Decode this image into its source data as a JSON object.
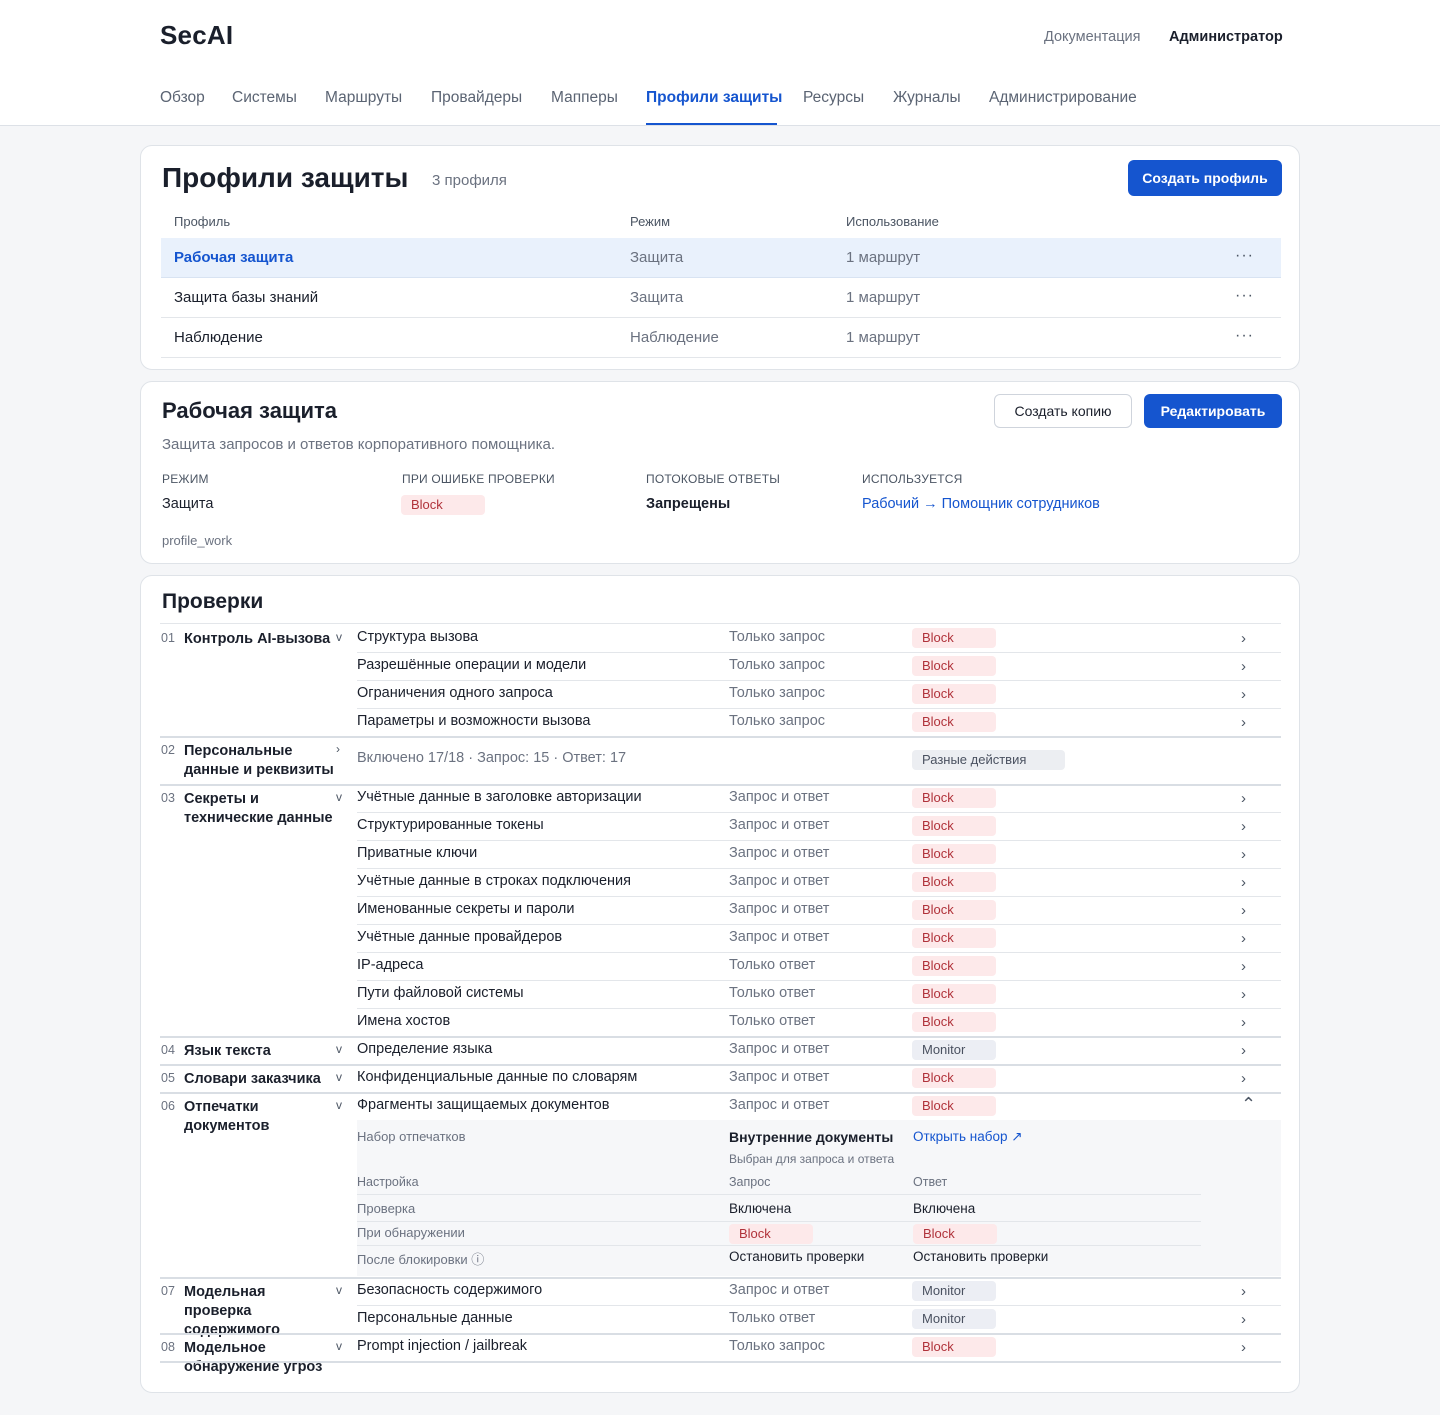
{
  "app": {
    "logo": "SecAI",
    "docs_link": "Документация",
    "user": "Администратор"
  },
  "nav": [
    "Обзор",
    "Системы",
    "Маршруты",
    "Провайдеры",
    "Мапперы",
    "Профили защиты",
    "Ресурсы",
    "Журналы",
    "Администрирование"
  ],
  "profiles": {
    "title": "Профили защиты",
    "count": "3 профиля",
    "create_button": "Создать профиль",
    "columns": [
      "Профиль",
      "Режим",
      "Использование"
    ],
    "rows": [
      {
        "name": "Рабочая защита",
        "mode": "Защита",
        "usage": "1 маршрут",
        "menu": "···"
      },
      {
        "name": "Защита базы знаний",
        "mode": "Защита",
        "usage": "1 маршрут",
        "menu": "···"
      },
      {
        "name": "Наблюдение",
        "mode": "Наблюдение",
        "usage": "1 маршрут",
        "menu": "···"
      }
    ]
  },
  "detail": {
    "title": "Рабочая защита",
    "description": "Защита запросов и ответов корпоративного помощника.",
    "copy_button": "Создать копию",
    "edit_button": "Редактировать",
    "fields": {
      "mode_label": "РЕЖИМ",
      "mode_value": "Защита",
      "on_error_label": "ПРИ ОШИБКЕ ПРОВЕРКИ",
      "on_error_value": "Block",
      "streaming_label": "ПОТОКОВЫЕ ОТВЕТЫ",
      "streaming_value": "Запрещены",
      "used_label": "ИСПОЛЬЗУЕТСЯ",
      "used_value": "Рабочий → Помощник сотрудников"
    },
    "id": "profile_work"
  },
  "checks": {
    "title": "Проверки",
    "groups": [
      {
        "num": "01",
        "name": "Контроль AI-вызова",
        "chev": "v",
        "items": [
          {
            "name": "Структура вызова",
            "dir": "Только запрос",
            "action": "Block"
          },
          {
            "name": "Разрешённые операции и модели",
            "dir": "Только запрос",
            "action": "Block"
          },
          {
            "name": "Ограничения одного запроса",
            "dir": "Только запрос",
            "action": "Block"
          },
          {
            "name": "Параметры и возможности вызова",
            "dir": "Только запрос",
            "action": "Block"
          }
        ]
      },
      {
        "num": "02",
        "name": "Персональные данные и реквизиты",
        "chev": "›",
        "summary": "Включено 17/18 · Запрос: 15 · Ответ: 17",
        "summary_action": "Разные действия"
      },
      {
        "num": "03",
        "name": "Секреты и технические данные",
        "chev": "v",
        "items": [
          {
            "name": "Учётные данные в заголовке авторизации",
            "dir": "Запрос и ответ",
            "action": "Block"
          },
          {
            "name": "Структурированные токены",
            "dir": "Запрос и ответ",
            "action": "Block"
          },
          {
            "name": "Приватные ключи",
            "dir": "Запрос и ответ",
            "action": "Block"
          },
          {
            "name": "Учётные данные в строках подключения",
            "dir": "Запрос и ответ",
            "action": "Block"
          },
          {
            "name": "Именованные секреты и пароли",
            "dir": "Запрос и ответ",
            "action": "Block"
          },
          {
            "name": "Учётные данные провайдеров",
            "dir": "Запрос и ответ",
            "action": "Block"
          },
          {
            "name": "IP-адреса",
            "dir": "Только ответ",
            "action": "Block"
          },
          {
            "name": "Пути файловой системы",
            "dir": "Только ответ",
            "action": "Block"
          },
          {
            "name": "Имена хостов",
            "dir": "Только ответ",
            "action": "Block"
          }
        ]
      },
      {
        "num": "04",
        "name": "Язык текста",
        "chev": "v",
        "items": [
          {
            "name": "Определение языка",
            "dir": "Запрос и ответ",
            "action": "Monitor"
          }
        ]
      },
      {
        "num": "05",
        "name": "Словари заказчика",
        "chev": "v",
        "items": [
          {
            "name": "Конфиденциальные данные по словарям",
            "dir": "Запрос и ответ",
            "action": "Block"
          }
        ]
      },
      {
        "num": "06",
        "name": "Отпечатки документов",
        "chev": "v",
        "items": [
          {
            "name": "Фрагменты защищаемых документов",
            "dir": "Запрос и ответ",
            "action": "Block"
          }
        ]
      },
      {
        "num": "07",
        "name": "Модельная проверка содержимого",
        "chev": "v",
        "items": [
          {
            "name": "Безопасность содержимого",
            "dir": "Запрос и ответ",
            "action": "Monitor"
          },
          {
            "name": "Персональные данные",
            "dir": "Только ответ",
            "action": "Monitor"
          }
        ]
      },
      {
        "num": "08",
        "name": "Модельное обнаружение угроз",
        "chev": "v",
        "items": [
          {
            "name": "Prompt injection / jailbreak",
            "dir": "Только запрос",
            "action": "Block"
          }
        ]
      }
    ],
    "row_arrow": "›",
    "expanded": {
      "set_label": "Набор отпечатков",
      "set_name": "Внутренние документы",
      "set_sub": "Выбран для запроса и ответа",
      "open_link": "Открыть набор ↗",
      "col_setting": "Настройка",
      "col_request": "Запрос",
      "col_response": "Ответ",
      "rows": [
        {
          "label": "Проверка",
          "req": "Включена",
          "resp": "Включена"
        },
        {
          "label": "При обнаружении",
          "req": "Block",
          "resp": "Block"
        },
        {
          "label": "После блокировки ⓘ",
          "req": "Остановить проверки",
          "resp": "Остановить проверки"
        }
      ]
    }
  }
}
